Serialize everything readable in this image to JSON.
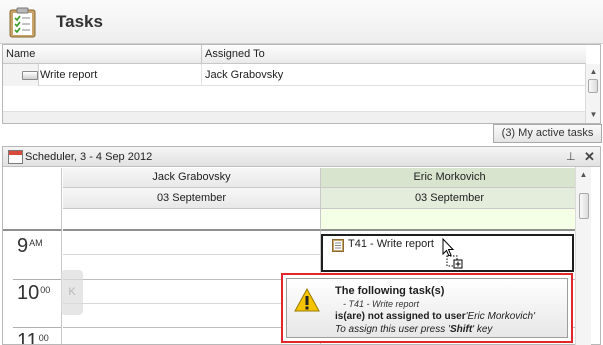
{
  "header": {
    "title": "Tasks"
  },
  "grid": {
    "columns": [
      "Name",
      "Assigned To"
    ],
    "rows": [
      {
        "name": "Write report",
        "assigned_to": "Jack Grabovsky"
      }
    ]
  },
  "active_tasks_button": "(3) My active tasks",
  "scheduler": {
    "title": "Scheduler, 3 - 4 Sep 2012",
    "resources": [
      {
        "name": "Jack Grabovsky",
        "date": "03 September"
      },
      {
        "name": "Eric Morkovich",
        "date": "03 September"
      }
    ],
    "hours": [
      {
        "num": "9",
        "sup": "AM"
      },
      {
        "num": "10",
        "sup": "00"
      },
      {
        "num": "11",
        "sup": "00"
      }
    ],
    "appointment": "T41 - Write report",
    "nav_prev": "K"
  },
  "tooltip": {
    "title": "The following task(s)",
    "task_item": "- T41 - Write report",
    "msg_prefix": "is(are) not assigned to user",
    "msg_user": "'Eric Morkovich'",
    "hint_prefix": "To assign this user press '",
    "hint_key": "Shift",
    "hint_suffix": "' key"
  },
  "colors": {
    "resource_active_bg": "#d9e4cf",
    "allday_active_bg": "#f4ffe6",
    "tooltip_border": "#e2262b"
  }
}
